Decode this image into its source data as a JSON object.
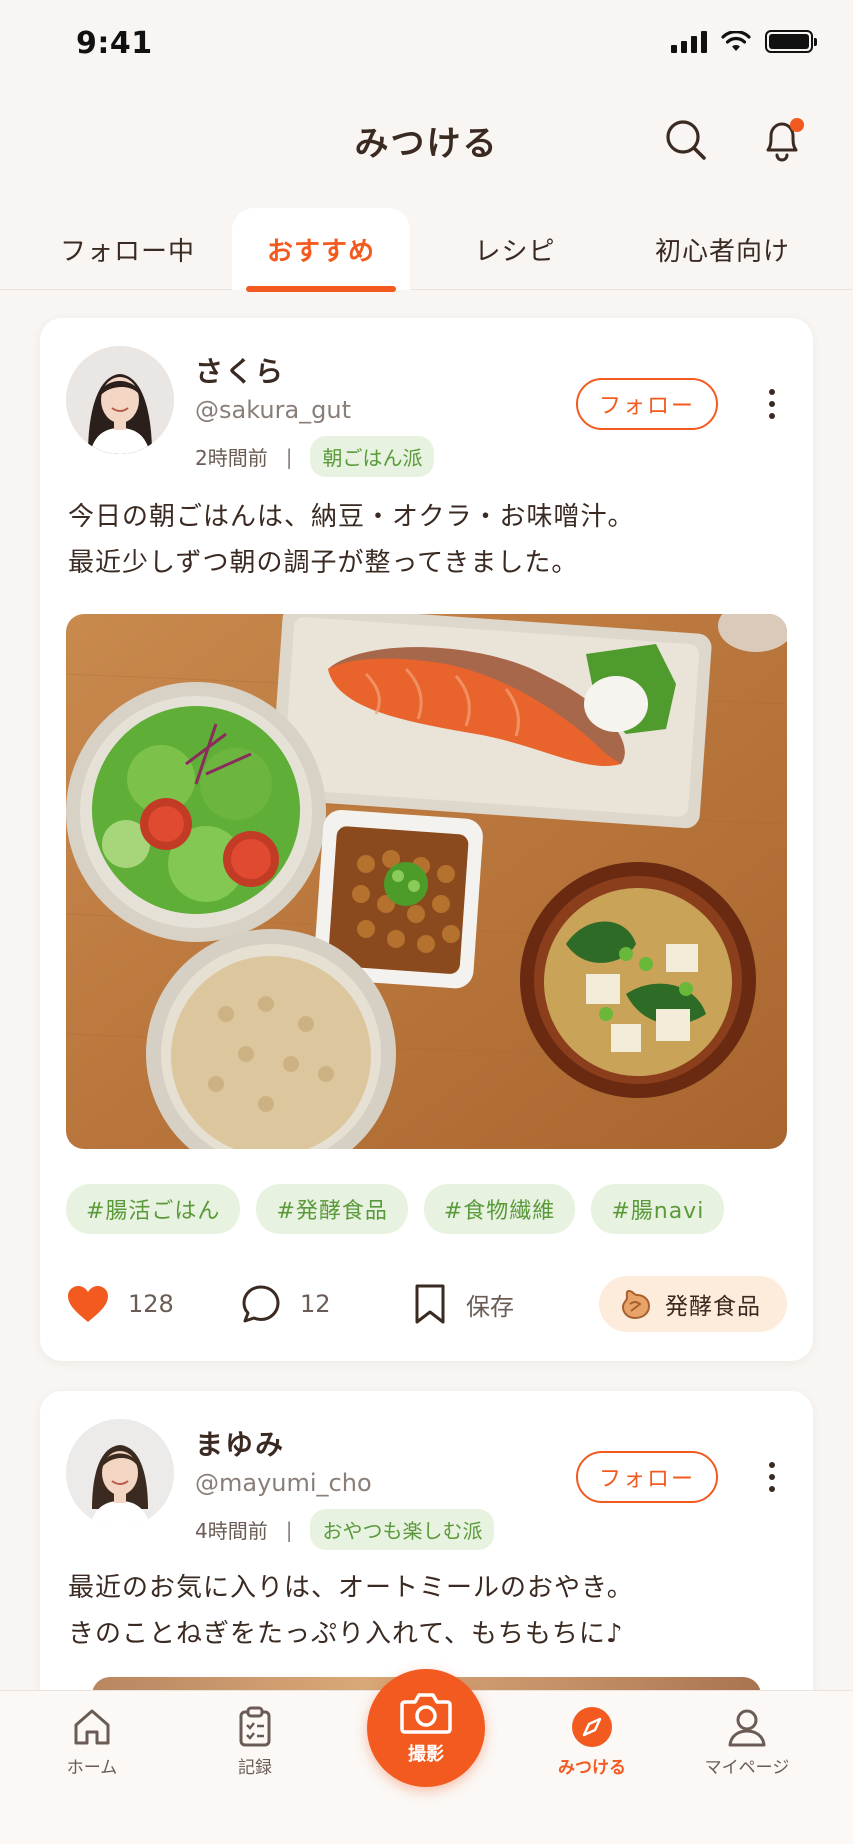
{
  "status_bar": {
    "time": "9:41"
  },
  "header": {
    "title": "みつける"
  },
  "tabs": [
    {
      "label": "フォロー中",
      "active": false
    },
    {
      "label": "おすすめ",
      "active": true
    },
    {
      "label": "レシピ",
      "active": false
    },
    {
      "label": "初心者向け",
      "active": false
    }
  ],
  "posts": [
    {
      "user": {
        "name": "さくら",
        "handle": "@sakura_gut"
      },
      "time_ago": "2時間前",
      "badge": "朝ごはん派",
      "follow_label": "フォロー",
      "text_lines": [
        "今日の朝ごはんは、納豆・オクラ・お味噌汁。",
        "最近少しずつ朝の調子が整ってきました。"
      ],
      "tags": [
        "#腸活ごはん",
        "#発酵食品",
        "#食物繊維",
        "#腸navi"
      ],
      "likes": "128",
      "comments": "12",
      "save_label": "保存",
      "category_label": "発酵食品"
    },
    {
      "user": {
        "name": "まゆみ",
        "handle": "@mayumi_cho"
      },
      "time_ago": "4時間前",
      "badge": "おやつも楽しむ派",
      "follow_label": "フォロー",
      "text_lines": [
        "最近のお気に入りは、オートミールのおやき。",
        "きのことねぎをたっぷり入れて、もちもちに♪"
      ]
    }
  ],
  "bottom_nav": {
    "home": "ホーム",
    "record": "記録",
    "camera": "撮影",
    "discover": "みつける",
    "mypage": "マイページ"
  },
  "colors": {
    "accent": "#f25a1f",
    "tag_bg": "#e8f2e0",
    "tag_text": "#5a9a3a",
    "background": "#f8f5f2"
  }
}
